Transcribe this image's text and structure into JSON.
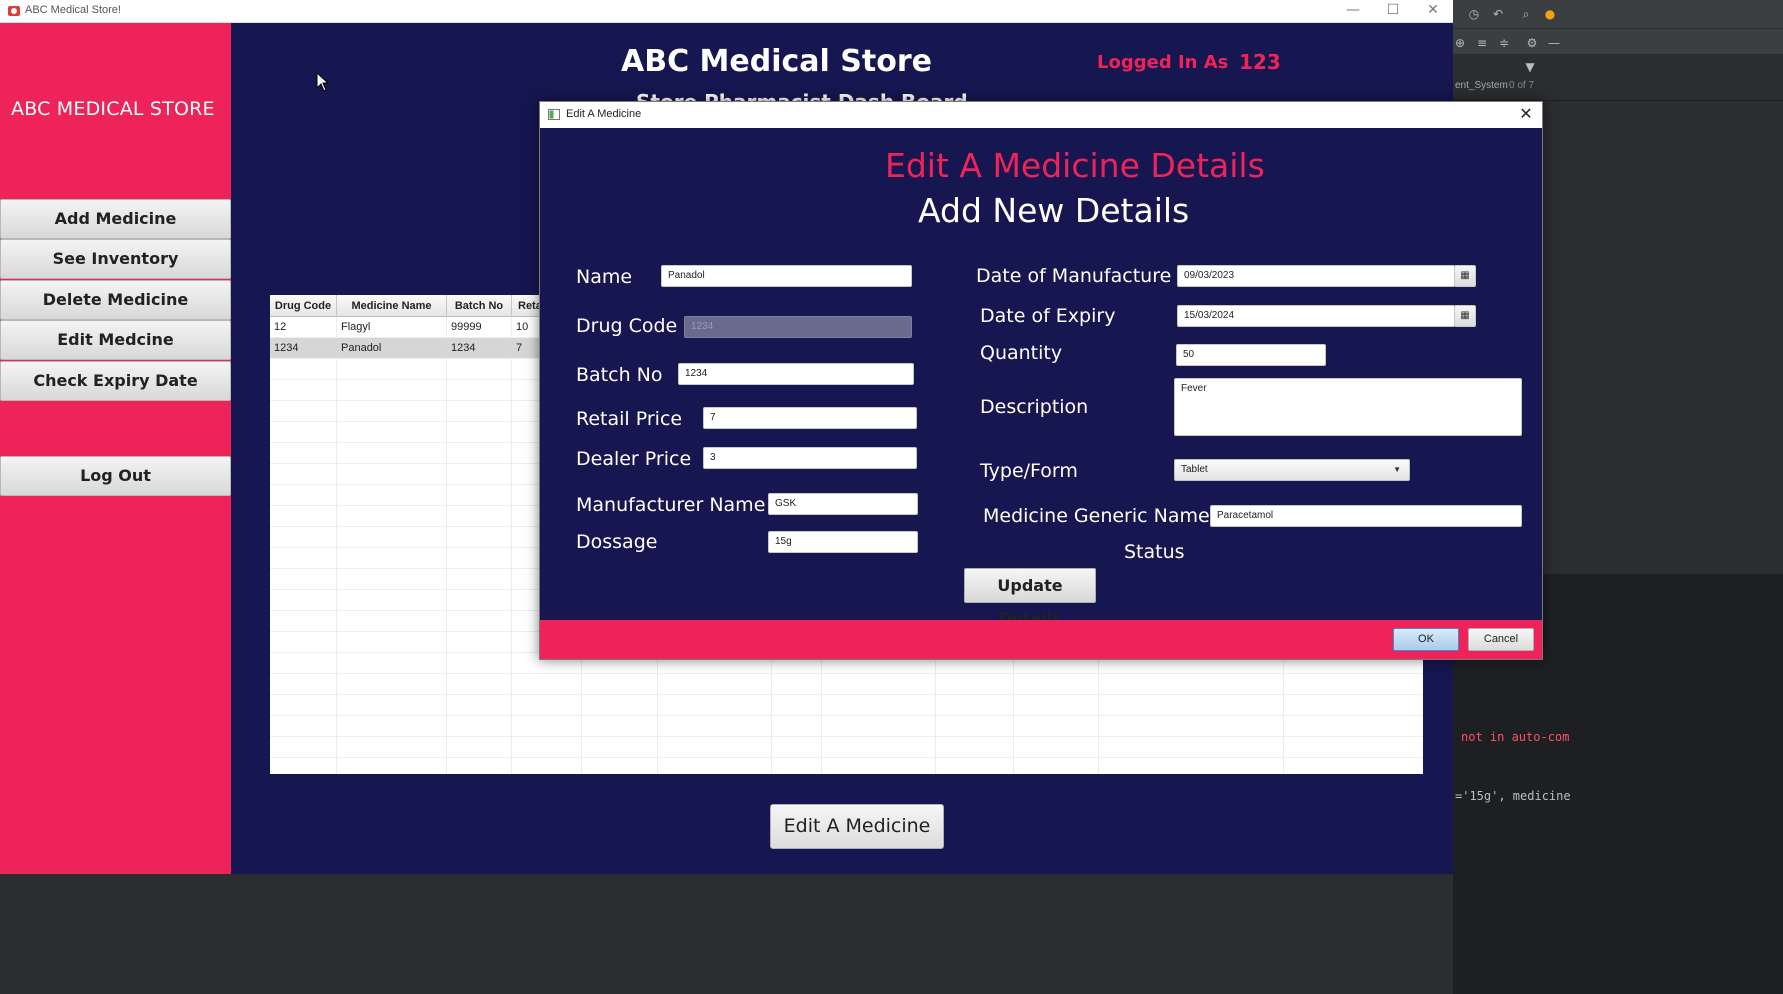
{
  "window": {
    "title": "ABC Medical Store!",
    "minimize_glyph": "—",
    "maximize_glyph": "☐",
    "close_glyph": "✕"
  },
  "sidebar": {
    "brand": "ABC MEDICAL STORE",
    "items": [
      {
        "label": "Add Medicine"
      },
      {
        "label": "See Inventory"
      },
      {
        "label": "Delete Medicine"
      },
      {
        "label": "Edit Medcine"
      },
      {
        "label": "Check Expiry Date"
      }
    ],
    "logout_label": "Log Out"
  },
  "header": {
    "title": "ABC Medical Store",
    "subtitle": "Store Pharmacist Dash Board",
    "logged_in_label": "Logged In As",
    "logged_in_user": "123"
  },
  "table": {
    "columns": [
      "Drug Code",
      "Medicine Name",
      "Batch No",
      "Reta"
    ],
    "rows": [
      [
        "12",
        "Flagyl",
        "99999",
        "10"
      ],
      [
        "1234",
        "Panadol",
        "1234",
        "7"
      ]
    ]
  },
  "main": {
    "edit_button_label": "Edit A Medicine"
  },
  "dialog": {
    "title": "Edit A Medicine",
    "close_glyph": "✕",
    "heading": "Edit A Medicine Details",
    "subheading": "Add New Details",
    "fields": {
      "name": {
        "label": "Name",
        "value": "Panadol"
      },
      "drug_code": {
        "label": "Drug Code",
        "value": "1234"
      },
      "batch_no": {
        "label": "Batch No",
        "value": "1234"
      },
      "retail_price": {
        "label": "Retail Price",
        "value": "7"
      },
      "dealer_price": {
        "label": "Dealer Price",
        "value": "3"
      },
      "manufacturer_name": {
        "label": "Manufacturer Name",
        "value": "GSK"
      },
      "dossage": {
        "label": "Dossage",
        "value": "15g"
      },
      "date_of_manufacture": {
        "label": "Date of Manufacture",
        "value": "09/03/2023"
      },
      "date_of_expiry": {
        "label": "Date of Expiry",
        "value": "15/03/2024"
      },
      "quantity": {
        "label": "Quantity",
        "value": "50"
      },
      "description": {
        "label": "Description",
        "value": "Fever"
      },
      "type_form": {
        "label": "Type/Form",
        "value": "Tablet"
      },
      "generic_name": {
        "label": "Medicine Generic Name",
        "value": "Paracetamol"
      },
      "status": {
        "label": "Status"
      }
    },
    "calendar_glyph": "▦",
    "dropdown_glyph": "▼",
    "update_button_label": "Update Details",
    "ok_label": "OK",
    "cancel_label": "Cancel"
  },
  "ide": {
    "tab_label": "ent_System",
    "tab_count": "0 of 7",
    "console_line_1": "not in auto-com",
    "console_line_2": "='15g', medicine"
  },
  "colors": {
    "accent": "#ed2359",
    "navy": "#161650",
    "ok_blue": "#3d8ed3"
  }
}
